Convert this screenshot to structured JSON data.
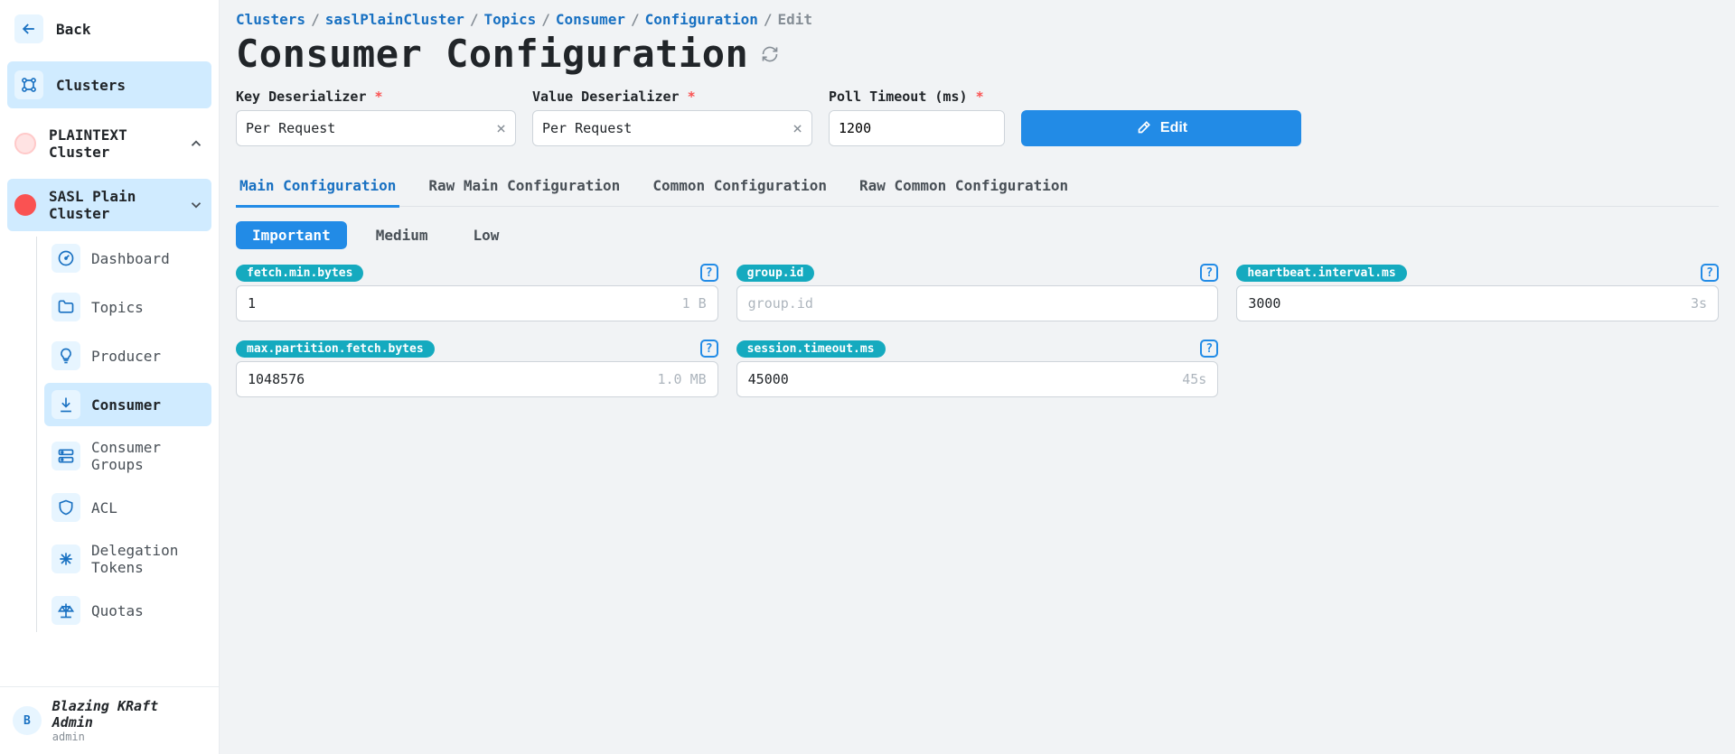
{
  "sidebar": {
    "back_label": "Back",
    "clusters_label": "Clusters",
    "clusters": [
      {
        "label": "PLAINTEXT Cluster",
        "expanded": false,
        "dot_bg": "#ffe3e3",
        "dot_border": "#ffc9c9",
        "active": false
      },
      {
        "label": "SASL Plain Cluster",
        "expanded": true,
        "dot_bg": "#fa5252",
        "dot_border": "#fa5252",
        "active": true
      }
    ],
    "items": [
      {
        "label": "Dashboard",
        "icon": "gauge"
      },
      {
        "label": "Topics",
        "icon": "folder"
      },
      {
        "label": "Producer",
        "icon": "bulb"
      },
      {
        "label": "Consumer",
        "icon": "download",
        "selected": true
      },
      {
        "label": "Consumer Groups",
        "icon": "server"
      },
      {
        "label": "ACL",
        "icon": "shield"
      },
      {
        "label": "Delegation Tokens",
        "icon": "asterisk"
      },
      {
        "label": "Quotas",
        "icon": "scale"
      }
    ],
    "user": {
      "avatar": "B",
      "name": "Blazing KRaft Admin",
      "role": "admin"
    }
  },
  "breadcrumb": [
    "Clusters",
    "saslPlainCluster",
    "Topics",
    "Consumer",
    "Configuration",
    "Edit"
  ],
  "page_title": "Consumer Configuration",
  "form": {
    "key_deserializer": {
      "label": "Key Deserializer",
      "value": "Per Request"
    },
    "value_deserializer": {
      "label": "Value Deserializer",
      "value": "Per Request"
    },
    "poll_timeout": {
      "label": "Poll Timeout (ms)",
      "value": "1200"
    },
    "edit_label": "Edit"
  },
  "tabs": [
    "Main Configuration",
    "Raw Main Configuration",
    "Common Configuration",
    "Raw Common Configuration"
  ],
  "active_tab": 0,
  "chips": [
    "Important",
    "Medium",
    "Low"
  ],
  "active_chip": 0,
  "configs": [
    {
      "name": "fetch.min.bytes",
      "value": "1",
      "hint": "1 B"
    },
    {
      "name": "group.id",
      "value": "",
      "placeholder": "group.id",
      "hint": ""
    },
    {
      "name": "heartbeat.interval.ms",
      "value": "3000",
      "hint": "3s"
    },
    {
      "name": "max.partition.fetch.bytes",
      "value": "1048576",
      "hint": "1.0 MB"
    },
    {
      "name": "session.timeout.ms",
      "value": "45000",
      "hint": "45s"
    }
  ]
}
